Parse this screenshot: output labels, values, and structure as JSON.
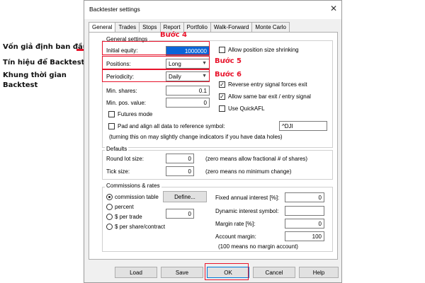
{
  "window": {
    "title": "Backtester settings",
    "close_glyph": "✕"
  },
  "tabs": [
    "General",
    "Trades",
    "Stops",
    "Report",
    "Portfolio",
    "Walk-Forward",
    "Monte Carlo"
  ],
  "general": {
    "group_label": "General settings",
    "initial_equity_label": "Initial equity:",
    "initial_equity_value": "1000000",
    "positions_label": "Positions:",
    "positions_value": "Long",
    "periodicity_label": "Periodicity:",
    "periodicity_value": "Daily",
    "min_shares_label": "Min. shares:",
    "min_shares_value": "0.1",
    "min_pos_value_label": "Min. pos. value:",
    "min_pos_value_value": "0",
    "futures_mode_label": "Futures mode",
    "pad_align_label": "Pad and align all data to reference symbol:",
    "reference_symbol_value": "^DJI",
    "pad_note": "(turning this on may slightly change indicators if you have data holes)",
    "allow_shrinking_label": "Allow position size shrinking",
    "reverse_entry_label": "Reverse entry signal forces exit",
    "same_bar_label": "Allow same bar exit / entry signal",
    "use_quickafl_label": "Use QuickAFL",
    "check_glyph": "✓"
  },
  "defaults": {
    "group_label": "Defaults",
    "round_lot_label": "Round lot size:",
    "round_lot_value": "0",
    "round_lot_note": "(zero means allow fractional # of shares)",
    "tick_size_label": "Tick size:",
    "tick_size_value": "0",
    "tick_size_note": "(zero means no minimum change)"
  },
  "commissions": {
    "group_label": "Commissions & rates",
    "radio_table": "commission table",
    "define_button": "Define...",
    "radio_percent": "percent",
    "radio_per_trade": "$ per trade",
    "per_trade_value": "0",
    "radio_per_share": "$ per share/contract",
    "fixed_interest_label": "Fixed annual interest [%]:",
    "fixed_interest_value": "0",
    "dynamic_interest_label": "Dynamic interest symbol:",
    "dynamic_interest_value": "",
    "margin_rate_label": "Margin rate [%]:",
    "margin_rate_value": "0",
    "account_margin_label": "Account margin:",
    "account_margin_value": "100",
    "account_margin_note": "(100 means no margin account)"
  },
  "buttons": {
    "load": "Load",
    "save": "Save",
    "ok": "OK",
    "cancel": "Cancel",
    "help": "Help"
  },
  "annotations": {
    "step4": "Bước 4",
    "step5": "Bước 5",
    "step6": "Bước 6",
    "label_equity": "Vốn giả định ban đầu",
    "label_signal": "Tín hiệu để Backtest",
    "label_period_1": "Khung thời gian",
    "label_period_2": "Backtest",
    "highlight_color": "#e8132b"
  }
}
